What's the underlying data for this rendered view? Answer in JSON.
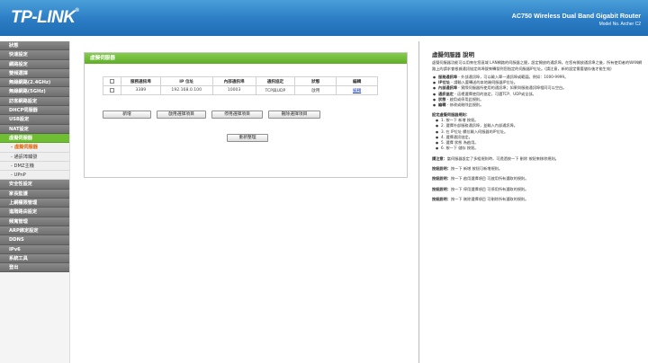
{
  "header": {
    "logo": "TP-LINK",
    "logo_mark": "®",
    "product": "AC750 Wireless Dual Band Gigabit Router",
    "model": "Model No. Archer C2"
  },
  "sidebar": {
    "items": [
      {
        "label": "狀態",
        "type": "main"
      },
      {
        "label": "快速設定",
        "type": "main"
      },
      {
        "label": "網路設定",
        "type": "main"
      },
      {
        "label": "雙頻選擇",
        "type": "main"
      },
      {
        "label": "無線網路(2.4GHz)",
        "type": "main"
      },
      {
        "label": "無線網路(5GHz)",
        "type": "main"
      },
      {
        "label": "訪客網路設定",
        "type": "main"
      },
      {
        "label": "DHCP伺服器",
        "type": "main"
      },
      {
        "label": "USB設定",
        "type": "main"
      },
      {
        "label": "NAT設定",
        "type": "main"
      },
      {
        "label": "虛擬伺服器",
        "type": "active"
      },
      {
        "label": "- 虛擬伺服器",
        "type": "sub-current"
      },
      {
        "label": "- 通訊埠觸發",
        "type": "sub"
      },
      {
        "label": "- DMZ主機",
        "type": "sub"
      },
      {
        "label": "- UPnP",
        "type": "sub"
      },
      {
        "label": "安全性設定",
        "type": "main"
      },
      {
        "label": "家長監護",
        "type": "main"
      },
      {
        "label": "上網權限管理",
        "type": "main"
      },
      {
        "label": "進階路由設定",
        "type": "main"
      },
      {
        "label": "頻寬管理",
        "type": "main"
      },
      {
        "label": "ARP綁定設定",
        "type": "main"
      },
      {
        "label": "DDNS",
        "type": "main"
      },
      {
        "label": "IPv6",
        "type": "main"
      },
      {
        "label": "系統工具",
        "type": "main"
      },
      {
        "label": "登出",
        "type": "main"
      }
    ]
  },
  "main": {
    "panel_title": "虛擬伺服器",
    "table": {
      "headers": [
        "",
        "服務通訊埠",
        "IP 位址",
        "內部通訊埠",
        "通訊協定",
        "狀態",
        "編輯"
      ],
      "rows": [
        {
          "service_port": "3389",
          "ip": "192.168.0.100",
          "internal_port": "10003",
          "protocol": "TCP與UDP",
          "status": "啟用",
          "edit": "編輯"
        }
      ]
    },
    "buttons": {
      "add": "新增",
      "enable_all": "啟用選擇項目",
      "disable_all": "停用選擇項目",
      "delete_all": "刪除選擇項目",
      "refresh": "重新整理"
    }
  },
  "help": {
    "title": "虛擬伺服器 說明",
    "intro": "虛擬伺服器功能可以用來在您區域 LAN網路的伺服器之間，設定開放的通訊埠。在您有開放通訊埠之後，所有使用者的WAN網路上的請求會根據通訊協定與埠號來轉發到您指定的伺服器IP位址。(請注意，新的設定需要儲存後才能生效)",
    "fields": [
      {
        "name": "服務通訊埠",
        "desc": " - 外部通訊埠，可以輸入單一通訊埠或範圍。例如：1000-9999。"
      },
      {
        "name": "IP位址",
        "desc": " - 請輸入要轉送的本地端伺服器IP位址。"
      },
      {
        "name": "內部通訊埠",
        "desc": " - 實際伺服器所使用的通訊埠；如果與服務通訊埠相同可以空白。"
      },
      {
        "name": "通訊協定",
        "desc": " - 這裡選擇使用的協定，可選TCP、UDP或全部。"
      },
      {
        "name": "狀態",
        "desc": " - 啟用或停用此規則。"
      },
      {
        "name": "編輯",
        "desc": " - 修改或刪除此規則。"
      }
    ],
    "steps_title": "設定虛擬伺服器規則：",
    "steps": [
      "1. 按一下 新增 按鈕。",
      "2. 選擇外部服務通訊埠，並輸入內部通訊埠。",
      "3. 在 IP位址 欄位輸入伺服器的IP位址。",
      "4. 選擇通訊協定。",
      "5. 選擇 狀態 為啟用。",
      "6. 按一下 儲存 按鈕。"
    ],
    "notes": [
      {
        "label": "請注意：",
        "text": "當伺服器設定了多組規則時，可透過按一下 刪除 按鈕來移除規則。"
      },
      {
        "label": "按鈕說明：",
        "text": "按一下 新增 按鈕可新增規則。"
      },
      {
        "label": "按鈕說明：",
        "text": "按一下 啟用選擇項目 可啟用所有選取的規則。"
      },
      {
        "label": "按鈕說明：",
        "text": "按一下 停用選擇項目 可停用所有選取的規則。"
      },
      {
        "label": "按鈕說明：",
        "text": "按一下 刪除選擇項目 可刪除所有選取的規則。"
      }
    ]
  }
}
